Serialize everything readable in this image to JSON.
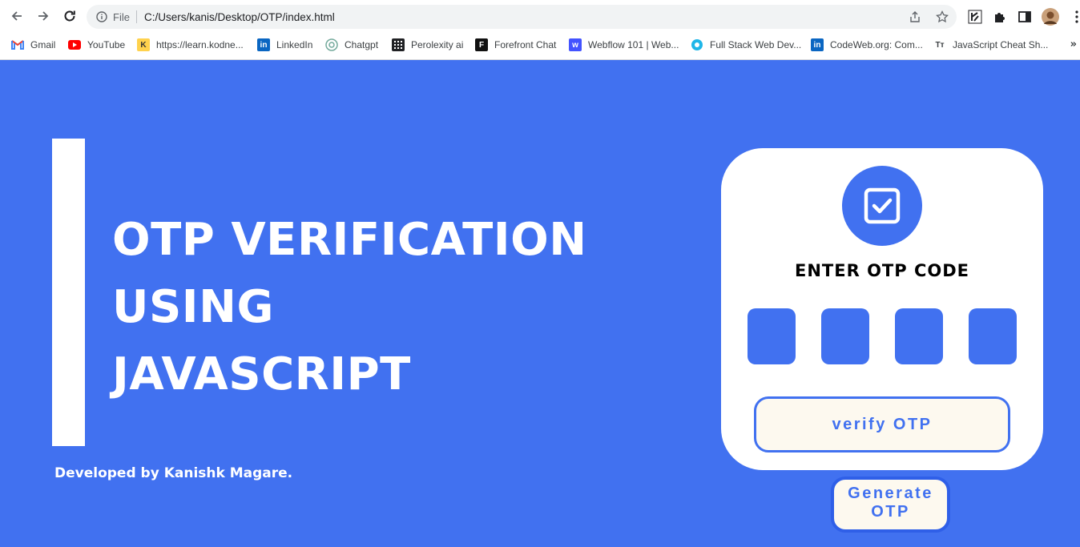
{
  "browser": {
    "scheme": "File",
    "url": "C:/Users/kanis/Desktop/OTP/index.html",
    "bookmarks": [
      {
        "label": "Gmail",
        "icon": "gmail-icon"
      },
      {
        "label": "YouTube",
        "icon": "youtube-icon"
      },
      {
        "label": "https://learn.kodne...",
        "icon": "kodnest-icon"
      },
      {
        "label": "LinkedIn",
        "icon": "linkedin-icon"
      },
      {
        "label": "Chatgpt",
        "icon": "chatgpt-icon"
      },
      {
        "label": "Perolexity ai",
        "icon": "perplexity-icon"
      },
      {
        "label": "Forefront Chat",
        "icon": "forefront-icon"
      },
      {
        "label": "Webflow 101 | Web...",
        "icon": "webflow-icon"
      },
      {
        "label": "Full Stack Web Dev...",
        "icon": "fullstack-icon"
      },
      {
        "label": "CodeWeb.org: Com...",
        "icon": "linkedin-icon"
      },
      {
        "label": "JavaScript Cheat Sh...",
        "icon": "tt-icon"
      }
    ],
    "bookmarks_more": "»"
  },
  "page": {
    "heading_lines": [
      "OTP VERIFICATION",
      "USING",
      "JAVASCRIPT"
    ],
    "credit": "Developed by Kanishk Magare."
  },
  "card": {
    "title": "ENTER OTP CODE",
    "otp_digits": [
      "",
      "",
      "",
      ""
    ],
    "verify_label": "verify OTP",
    "icon": "checkbox-icon"
  },
  "generate_label_line1": "Generate",
  "generate_label_line2": "OTP",
  "colors": {
    "background": "#4171f0",
    "card": "#ffffff",
    "button_bg": "#fdf9ef",
    "accent": "#4171f0"
  }
}
